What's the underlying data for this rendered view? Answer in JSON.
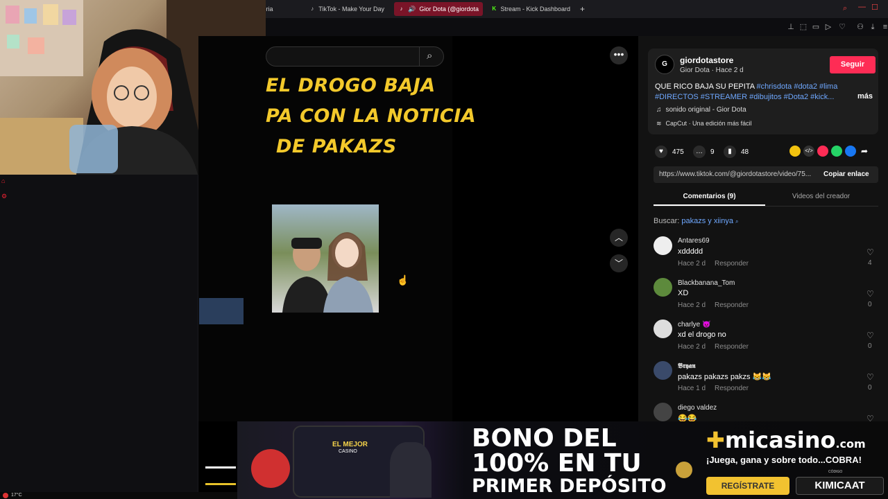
{
  "browser": {
    "tabs": [
      {
        "label": "toria",
        "icon": "generic-tab-icon"
      },
      {
        "label": "TikTok - Make Your Day",
        "icon": "tiktok-icon"
      },
      {
        "label": "Gior Dota (@giordota",
        "icon": "tiktok-icon"
      },
      {
        "label": "Stream - Kick Dashboard",
        "icon": "kick-icon"
      }
    ],
    "new_tab": "+"
  },
  "video": {
    "meme_lines": [
      "EL DROGO BAJA",
      "PA CON LA NOTICIA",
      "DE PAKAZS"
    ]
  },
  "post": {
    "username": "giordotastore",
    "subline": "Gior Dota · Hace 2 d",
    "follow_label": "Seguir",
    "caption_text": "QUE RICO BAJA SU PEPITA ",
    "caption_tags_1": "#chrisdota #dota2 #lima",
    "caption_tags_2": "#DIRECTOS #STREAMER #dibujitos #Dota2 #kick...",
    "more_label": "más",
    "sound": "sonido original - Gior Dota",
    "capcut": "CapCut · Una edición más fácil",
    "likes": "475",
    "comments": "9",
    "saves": "48",
    "url": "https://www.tiktok.com/@giordotastore/video/75...",
    "copy_label": "Copiar enlace",
    "tab_comments": "Comentarios (9)",
    "tab_videos": "Videos del creador",
    "search_prefix": "Buscar:",
    "search_term": "pakazs y xiinya"
  },
  "comments": [
    {
      "name": "Antares69",
      "text": "xddddd",
      "time": "Hace 2 d",
      "reply": "Responder",
      "likes": "4"
    },
    {
      "name": "Blackbanana_Tom",
      "text": "XD",
      "time": "Hace 2 d",
      "reply": "Responder",
      "likes": "0"
    },
    {
      "name": "charlye 😈",
      "text": "xd el drogo no",
      "time": "Hace 2 d",
      "reply": "Responder",
      "likes": "0"
    },
    {
      "name": "𝕭𝖗𝖞𝖆𝖓",
      "text": "pakazs pakazs pakzs 😹😹",
      "time": "Hace 1 d",
      "reply": "Responder",
      "likes": "0"
    },
    {
      "name": "diego valdez",
      "text": "😂😂",
      "time": "",
      "reply": "",
      "likes": ""
    }
  ],
  "ad": {
    "line1": "BONO DEL",
    "line2": "100% EN TU",
    "line3": "PRIMER DEPÓSITO",
    "brand": "micasino",
    "brand_suffix": ".com",
    "slogan": "¡Juega, gana y sobre todo...COBRA!",
    "code_label": "CÓDIGO",
    "register": "REGÍSTRATE",
    "code": "KIMICAAT",
    "phone_title": "EL MEJOR",
    "phone_sub": "CASINO"
  },
  "status": {
    "temperature": "17°C"
  },
  "colors": {
    "follow": "#fe2c55",
    "tab_active": "#7a1428",
    "meme_text": "#f3c92b",
    "link": "#6fa8ff",
    "code_button": "#f2c230"
  }
}
